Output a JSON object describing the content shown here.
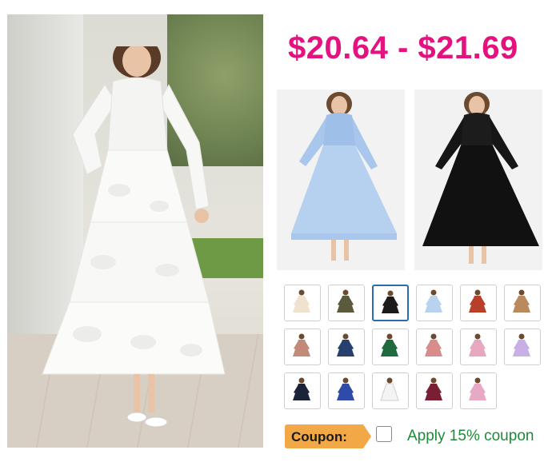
{
  "product": {
    "price_range": "$20.64 - $21.69"
  },
  "colors": {
    "price": "#e3127e",
    "selected_border": "#2b6cb0",
    "coupon_badge": "#f3a847",
    "coupon_link": "#1f8a3a"
  },
  "swatches": [
    {
      "color": "#efe3cf",
      "selected": false
    },
    {
      "color": "#5b5a3c",
      "selected": false
    },
    {
      "color": "#1b1b1b",
      "selected": true
    },
    {
      "color": "#b9d3ef",
      "selected": false
    },
    {
      "color": "#b8402a",
      "selected": false
    },
    {
      "color": "#b98a5e",
      "selected": false
    },
    {
      "color": "#c28a78",
      "selected": false
    },
    {
      "color": "#27406e",
      "selected": false
    },
    {
      "color": "#1f6b3f",
      "selected": false
    },
    {
      "color": "#d98c8c",
      "selected": false
    },
    {
      "color": "#e8a8c0",
      "selected": false
    },
    {
      "color": "#c8b0e6",
      "selected": false
    },
    {
      "color": "#1b2338",
      "selected": false
    },
    {
      "color": "#2f4aa8",
      "selected": false
    },
    {
      "color": "#f4f4f4",
      "selected": false
    },
    {
      "color": "#7a1f33",
      "selected": false
    },
    {
      "color": "#e7a9c6",
      "selected": false
    }
  ],
  "coupon": {
    "badge_label": "Coupon:",
    "apply_label": "Apply 15% coupon",
    "checked": false
  }
}
